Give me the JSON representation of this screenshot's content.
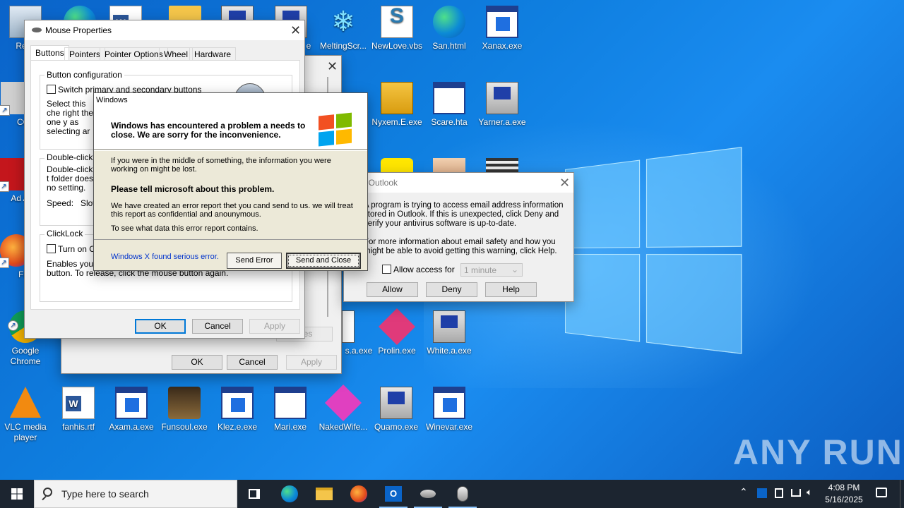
{
  "desktop": {
    "icons": [
      {
        "label": "Recy"
      },
      {
        "label": "CCl"
      },
      {
        "label": "Ad Acr"
      },
      {
        "label": "Fir"
      },
      {
        "label": "Google Chrome"
      },
      {
        "label": "e"
      },
      {
        "label": "MeltingScr..."
      },
      {
        "label": "NewLove.vbs"
      },
      {
        "label": "San.html"
      },
      {
        "label": "Xanax.exe"
      },
      {
        "label": "Nyxem.E.exe"
      },
      {
        "label": "Scare.hta"
      },
      {
        "label": "Yarner.a.exe"
      },
      {
        "label": "s.a.exe"
      },
      {
        "label": "Prolin.exe"
      },
      {
        "label": "White.a.exe"
      },
      {
        "label": "VLC media player"
      },
      {
        "label": "fanhis.rtf"
      },
      {
        "label": "Axam.a.exe"
      },
      {
        "label": "Funsoul.exe"
      },
      {
        "label": "Klez.e.exe"
      },
      {
        "label": "Mari.exe"
      },
      {
        "label": "NakedWife..."
      },
      {
        "label": "Quamo.exe"
      },
      {
        "label": "Winevar.exe"
      }
    ],
    "watermark": "ANY RUN"
  },
  "back_dialog": {
    "ok": "OK",
    "cancel": "Cancel",
    "apply": "Apply",
    "properties": "rties"
  },
  "mouse_properties": {
    "title": "Mouse Properties",
    "tabs": [
      "Buttons",
      "Pointers",
      "Pointer Options",
      "Wheel",
      "Hardware"
    ],
    "button_config": {
      "title": "Button configuration",
      "checkbox": "Switch primary and secondary buttons",
      "desc": "Select this che right the one y as selecting ar"
    },
    "double_click": {
      "title": "Double-click s",
      "desc": "Double-click t folder does no setting.",
      "speed_label": "Speed:",
      "speed_value": "Slov"
    },
    "clicklock": {
      "title": "ClickLock",
      "checkbox": "Turn on Cli",
      "desc": "Enables you to button. To set, briefly press the mouse button. To release, click the mouse button again."
    },
    "ok": "OK",
    "cancel": "Cancel",
    "apply": "Apply"
  },
  "error_dialog": {
    "title": "Windows",
    "header": "Windows has encountered a problem a needs to close. We are sorry for the inconvenience.",
    "info": "If you were in the middle of something, the information you were working on might be lost.",
    "tell": "Please tell microsoft about this problem.",
    "report": "We have created an error report thet you cand send to us. we will treat this report as confidential and anounymous.",
    "see": "To see what data this error report contains.",
    "footer_link": "Windows X found serious error.",
    "send_error": "Send Error",
    "send_close": "Send and Close"
  },
  "outlook_dialog": {
    "title": "t Outlook",
    "p1": "A program is trying to access email address information stored in Outlook. If this is unexpected, click Deny and verify your antivirus software is up-to-date.",
    "p2": "For more information about email safety and how you might be able to avoid getting this warning, click Help.",
    "allow_access": "Allow access for",
    "duration": "1 minute",
    "allow": "Allow",
    "deny": "Deny",
    "help": "Help"
  },
  "taskbar": {
    "search_placeholder": "Type here to search",
    "time": "4:08 PM",
    "date": "5/16/2025"
  }
}
